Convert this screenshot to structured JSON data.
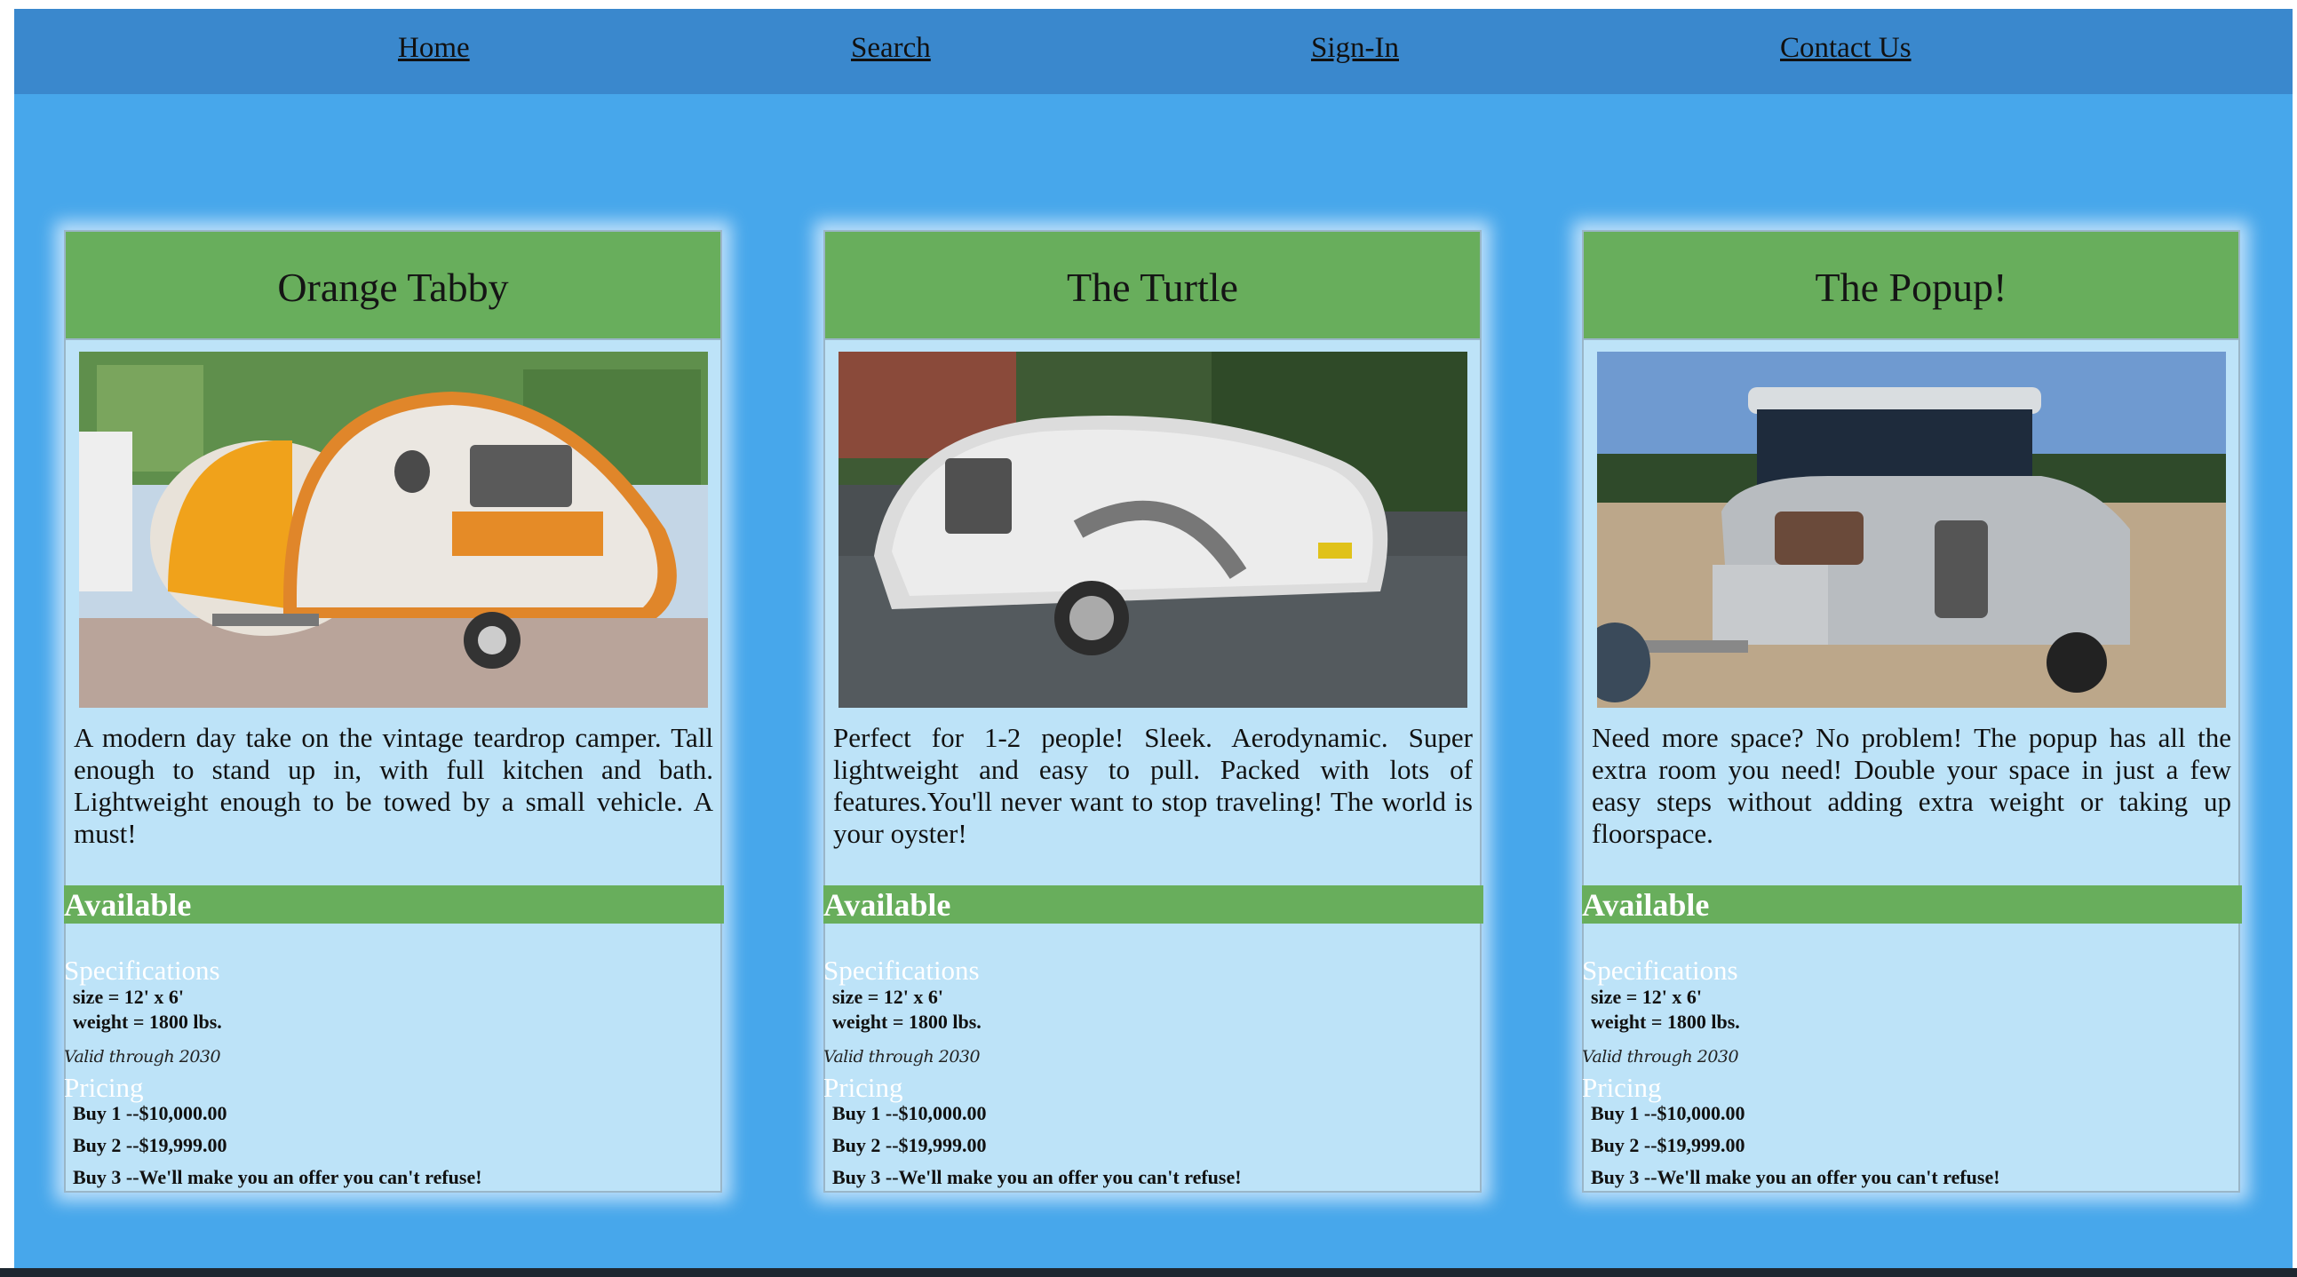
{
  "nav": {
    "home": "Home",
    "search": "Search",
    "signin": "Sign-In",
    "contact": "Contact Us"
  },
  "cards": [
    {
      "title": "Orange Tabby",
      "image": "orange-white-teardrop-camper-photo",
      "description": "A modern day take on the vintage teardrop camper. Tall enough to stand up in, with full kitchen and bath. Lightweight enough to be towed by a small vehicle. A must!",
      "availability": "Available",
      "specs_heading": "Specifications",
      "size": "size = 12' x 6'",
      "weight": "weight = 1800 lbs.",
      "valid": "Valid through 2030",
      "pricing_heading": "Pricing",
      "price_1": "Buy 1 --$10,000.00",
      "price_2": "Buy 2 --$19,999.00",
      "price_3": "Buy 3 --We'll make you an offer you can't refuse!"
    },
    {
      "title": "The Turtle",
      "image": "white-turtle-teardrop-trailer-photo",
      "description": "Perfect for 1-2 people! Sleek. Aerodynamic. Super lightweight and easy to pull. Packed with lots of features.You'll never want to stop traveling! The world is your oyster!",
      "availability": "Available",
      "specs_heading": "Specifications",
      "size": "size = 12' x 6'",
      "weight": "weight = 1800 lbs.",
      "valid": "Valid through 2030",
      "pricing_heading": "Pricing",
      "price_1": "Buy 1 --$10,000.00",
      "price_2": "Buy 2 --$19,999.00",
      "price_3": "Buy 3 --We'll make you an offer you can't refuse!"
    },
    {
      "title": "The Popup!",
      "image": "silver-popup-camper-trailer-photo",
      "description": "Need more space? No problem! The popup has all the extra room you need! Double your space in just a few easy steps without adding extra weight or taking up floorspace.",
      "availability": "Available",
      "specs_heading": "Specifications",
      "size": "size = 12' x 6'",
      "weight": "weight = 1800 lbs.",
      "valid": "Valid through 2030",
      "pricing_heading": "Pricing",
      "price_1": "Buy 1 --$10,000.00",
      "price_2": "Buy 2 --$19,999.00",
      "price_3": "Buy 3 --We'll make you an offer you can't refuse!"
    }
  ],
  "colors": {
    "page_background": "#47a7eb",
    "navbar": "#3a88cd",
    "card_header": "#68ae5c",
    "card_body": "#bde3f8"
  }
}
